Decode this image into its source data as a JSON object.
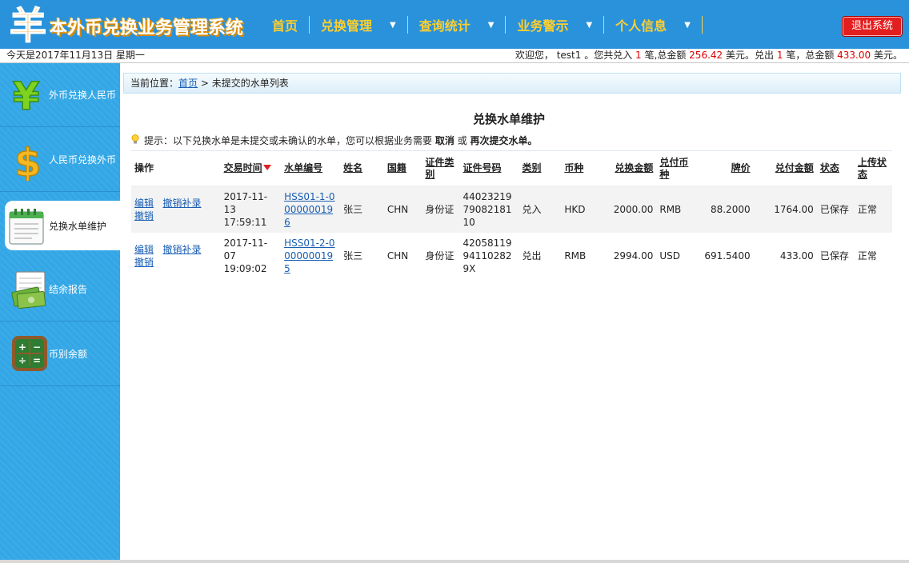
{
  "header": {
    "logo_char": "羊",
    "title": "本外币兑换业务管理系统",
    "nav": [
      {
        "label": "首页",
        "dropdown": false
      },
      {
        "label": "兑换管理",
        "dropdown": true
      },
      {
        "label": "查询统计",
        "dropdown": true
      },
      {
        "label": "业务警示",
        "dropdown": true
      },
      {
        "label": "个人信息",
        "dropdown": true
      }
    ],
    "logout_label": "退出系统"
  },
  "statusbar": {
    "today": "今天是2017年11月13日 星期一",
    "welcome_prefix": "欢迎您， test1 。您共兑入",
    "in_count": "1",
    "in_mid": "笔,总金额",
    "in_amount": "256.42",
    "in_unit": "美元。兑出",
    "out_count": "1",
    "out_mid": "笔，总金额",
    "out_amount": "433.00",
    "out_unit": "美元。"
  },
  "sidebar": {
    "items": [
      {
        "label": "外币兑换人民币",
        "icon": "yuan-icon"
      },
      {
        "label": "人民币兑换外币",
        "icon": "dollar-icon"
      },
      {
        "label": "兑换水单维护",
        "icon": "notepad-icon"
      },
      {
        "label": "结余报告",
        "icon": "cash-report-icon"
      },
      {
        "label": "币别余额",
        "icon": "calculator-icon"
      }
    ]
  },
  "main": {
    "breadcrumb_prefix": "当前位置：",
    "breadcrumb_home": "首页",
    "breadcrumb_sep": ">",
    "breadcrumb_current": "未提交的水单列表",
    "page_title": "兑换水单维护",
    "tip_text": "提示：以下兑换水单是未提交或未确认的水单，您可以根据业务需要",
    "tip_cancel": "取消",
    "tip_or": "或",
    "tip_resubmit": "再次提交水单。",
    "columns": [
      "操作",
      "交易时间",
      "水单编号",
      "姓名",
      "国籍",
      "证件类别",
      "证件号码",
      "类别",
      "币种",
      "兑换金额",
      "兑付币种",
      "牌价",
      "兑付金额",
      "状态",
      "上传状态"
    ],
    "action_edit": "编辑",
    "action_cancel_supplement": "撤销补录",
    "action_revoke": "撤销",
    "rows": [
      {
        "time": "2017-11-13 17:59:11",
        "receipt": "HSS01-1-0000000196",
        "name": "张三",
        "nation": "CHN",
        "id_type": "身份证",
        "id_no": "440232197908218110",
        "kind": "兑入",
        "currency": "HKD",
        "amount": "2000.00",
        "pay_currency": "RMB",
        "rate": "88.2000",
        "pay_amount": "1764.00",
        "status": "已保存",
        "upload": "正常"
      },
      {
        "time": "2017-11-07 19:09:02",
        "receipt": "HSS01-2-0000000195",
        "name": "张三",
        "nation": "CHN",
        "id_type": "身份证",
        "id_no": "42058119941102829X",
        "kind": "兑出",
        "currency": "RMB",
        "amount": "2994.00",
        "pay_currency": "USD",
        "rate": "691.5400",
        "pay_amount": "433.00",
        "status": "已保存",
        "upload": "正常"
      }
    ]
  },
  "colors": {
    "header_bg": "#2a92da",
    "nav_text": "#ffcf2e",
    "sidebar_bg": "#33a7e6",
    "logout_bg": "#e31e1e",
    "link": "#1a5fb4",
    "highlight": "#dd0000"
  }
}
